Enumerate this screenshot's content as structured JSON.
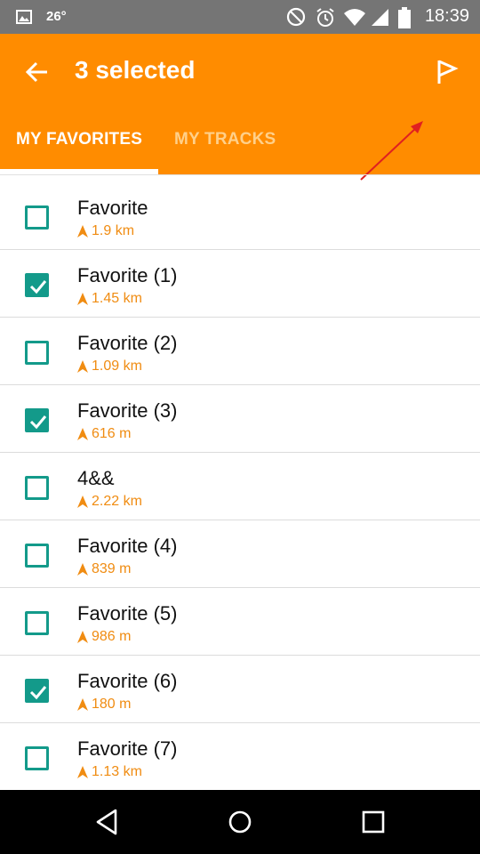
{
  "status_bar": {
    "temperature": "26°",
    "time": "18:39",
    "icons": [
      "gallery-icon",
      "dnd-icon",
      "alarm-icon",
      "wifi-icon",
      "signal-icon",
      "battery-icon"
    ]
  },
  "app_bar": {
    "title": "3 selected",
    "back_icon": "arrow-left-icon",
    "action_icon": "flag-icon",
    "color": "#ff8c00"
  },
  "tabs": [
    {
      "label": "MY FAVORITES",
      "active": true
    },
    {
      "label": "MY TRACKS",
      "active": false
    }
  ],
  "favorites": [
    {
      "name": "Favorite",
      "distance": "1.9 km",
      "checked": false
    },
    {
      "name": "Favorite (1)",
      "distance": "1.45 km",
      "checked": true
    },
    {
      "name": "Favorite (2)",
      "distance": "1.09 km",
      "checked": false
    },
    {
      "name": "Favorite (3)",
      "distance": "616 m",
      "checked": true
    },
    {
      "name": "4&&",
      "distance": "2.22 km",
      "checked": false
    },
    {
      "name": "Favorite (4)",
      "distance": "839 m",
      "checked": false
    },
    {
      "name": "Favorite (5)",
      "distance": "986 m",
      "checked": false
    },
    {
      "name": "Favorite (6)",
      "distance": "180 m",
      "checked": true
    },
    {
      "name": "Favorite (7)",
      "distance": "1.13 km",
      "checked": false
    }
  ],
  "colors": {
    "accent": "#ff8c00",
    "checkbox": "#139a8a",
    "distance": "#f08c12"
  },
  "nav_bar": [
    "back-icon",
    "home-icon",
    "recents-icon"
  ]
}
